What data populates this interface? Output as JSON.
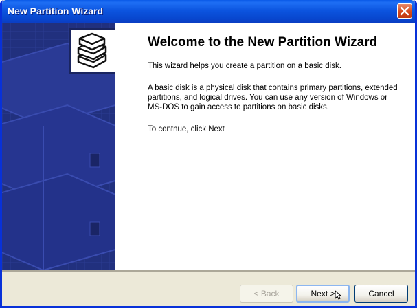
{
  "window": {
    "title": "New Partition Wizard"
  },
  "content": {
    "heading": "Welcome to the New Partition Wizard",
    "paragraphs": [
      "This wizard helps you create a partition on a basic disk.",
      "A basic disk is a physical disk that contains primary partitions, extended partitions, and logical drives. You can use any version of Windows or MS-DOS to gain access to partitions on basic disks.",
      "To contnue, click Next"
    ]
  },
  "buttons": {
    "back": "< Back",
    "next": "Next >",
    "cancel": "Cancel"
  },
  "icons": {
    "close": "close-icon",
    "logo": "disk-stack-icon",
    "cursor": "mouse-pointer-icon"
  },
  "colors": {
    "titlebar": "#0a4fd8",
    "banner": "#21307e",
    "close_button": "#d4481b"
  }
}
